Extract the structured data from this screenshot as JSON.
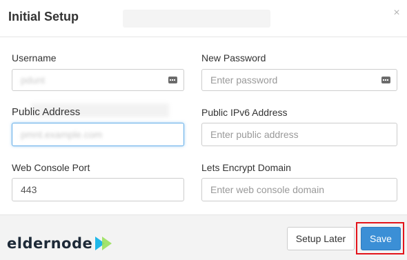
{
  "dialog": {
    "title": "Initial Setup",
    "close_glyph": "×"
  },
  "fields": {
    "username": {
      "label": "Username",
      "value": "pdunt"
    },
    "new_password": {
      "label": "New Password",
      "placeholder": "Enter password"
    },
    "public_address": {
      "label": "Public Address",
      "value": "pmnt.example.com"
    },
    "public_ipv6": {
      "label": "Public IPv6 Address",
      "placeholder": "Enter public address"
    },
    "web_console_port": {
      "label": "Web Console Port",
      "value": "443"
    },
    "lets_encrypt": {
      "label": "Lets Encrypt Domain",
      "placeholder": "Enter web console domain"
    }
  },
  "footer": {
    "setup_later_label": "Setup Later",
    "save_label": "Save"
  },
  "watermark": {
    "text": "eldernode",
    "icon": "play-arrows-icon"
  },
  "colors": {
    "primary": "#3b8fd6",
    "highlight": "#e3141b",
    "focus": "#66afe9",
    "logo_accent": "#1fb7e8"
  }
}
